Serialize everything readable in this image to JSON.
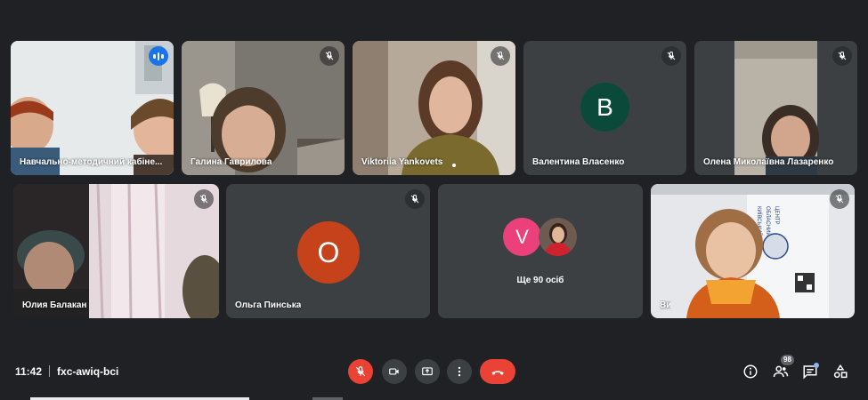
{
  "participants": [
    {
      "name": "Навчально-методичний кабіне...",
      "status": "speaking"
    },
    {
      "name": "Галина Гаврилова",
      "status": "muted"
    },
    {
      "name": "Viktoriia Yankovets",
      "status": "muted"
    },
    {
      "name": "Валентина Власенко",
      "status": "muted",
      "avatar_letter": "B",
      "avatar_color": "#0b4a3b"
    },
    {
      "name": "Олена Миколаївна Лазаренко",
      "status": "muted"
    },
    {
      "name": "Юлия Балакан",
      "status": "muted"
    },
    {
      "name": "Ольга Пинська",
      "status": "muted",
      "avatar_letter": "O",
      "avatar_color": "#c5421a"
    },
    {
      "name": "Ви",
      "status": "muted"
    }
  ],
  "others": {
    "avatar_letter": "V",
    "avatar_color": "#ec407a",
    "label": "Ще 90 осіб"
  },
  "meeting": {
    "time": "11:42",
    "code": "fxc-awiq-bci"
  },
  "controls": {
    "people_count": "98",
    "accent_red": "#ea4335",
    "accent_blue": "#8ab4f8"
  },
  "icons": [
    "mic-off-icon",
    "camera-icon",
    "present-icon",
    "more-icon",
    "end-call-icon",
    "info-icon",
    "people-icon",
    "chat-icon",
    "activities-icon"
  ]
}
